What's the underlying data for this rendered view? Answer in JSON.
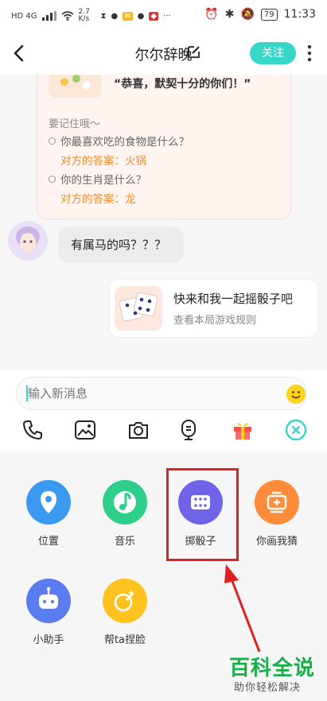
{
  "status_bar": {
    "left_text": "HD 4G",
    "speed": "2.7 K/s",
    "battery": "79",
    "time": "11:33"
  },
  "header": {
    "title": "尔尔辞晚",
    "follow_label": "关注"
  },
  "card": {
    "quote": "“恭喜，默契十分的你们！”",
    "remember": "要记住哦～",
    "items": [
      {
        "question": "你最喜欢吃的食物是什么？",
        "answer": "对方的答案：火锅"
      },
      {
        "question": "你的生肖是什么？",
        "answer": "对方的答案：龙"
      }
    ]
  },
  "messages": {
    "incoming_text": "有属马的吗？？？"
  },
  "game_card": {
    "title": "快来和我一起摇骰子吧",
    "subtitle": "查看本局游戏规则"
  },
  "input": {
    "placeholder": "输入新消息"
  },
  "toolbar_icons": [
    "phone-icon",
    "image-icon",
    "camera-icon",
    "voice-icon",
    "gift-icon",
    "close-icon"
  ],
  "apps": [
    {
      "label": "位置",
      "color": "#3a9af0",
      "icon": "location-icon"
    },
    {
      "label": "音乐",
      "color": "#2ecf8a",
      "icon": "music-icon"
    },
    {
      "label": "掷骰子",
      "color": "#6f64e8",
      "icon": "dice-icon"
    },
    {
      "label": "你画我猜",
      "color": "#ff8c3a",
      "icon": "draw-guess-icon"
    },
    {
      "label": "小助手",
      "color": "#5a7cf0",
      "icon": "robot-icon"
    },
    {
      "label": "帮ta捏脸",
      "color": "#ffc21e",
      "icon": "face-edit-icon"
    }
  ],
  "colors": {
    "accent": "#36d6c8",
    "answer": "#f08c2a",
    "highlight": "#e02020"
  },
  "watermark": {
    "main": "百科全说",
    "sub": "助你轻松解决"
  }
}
